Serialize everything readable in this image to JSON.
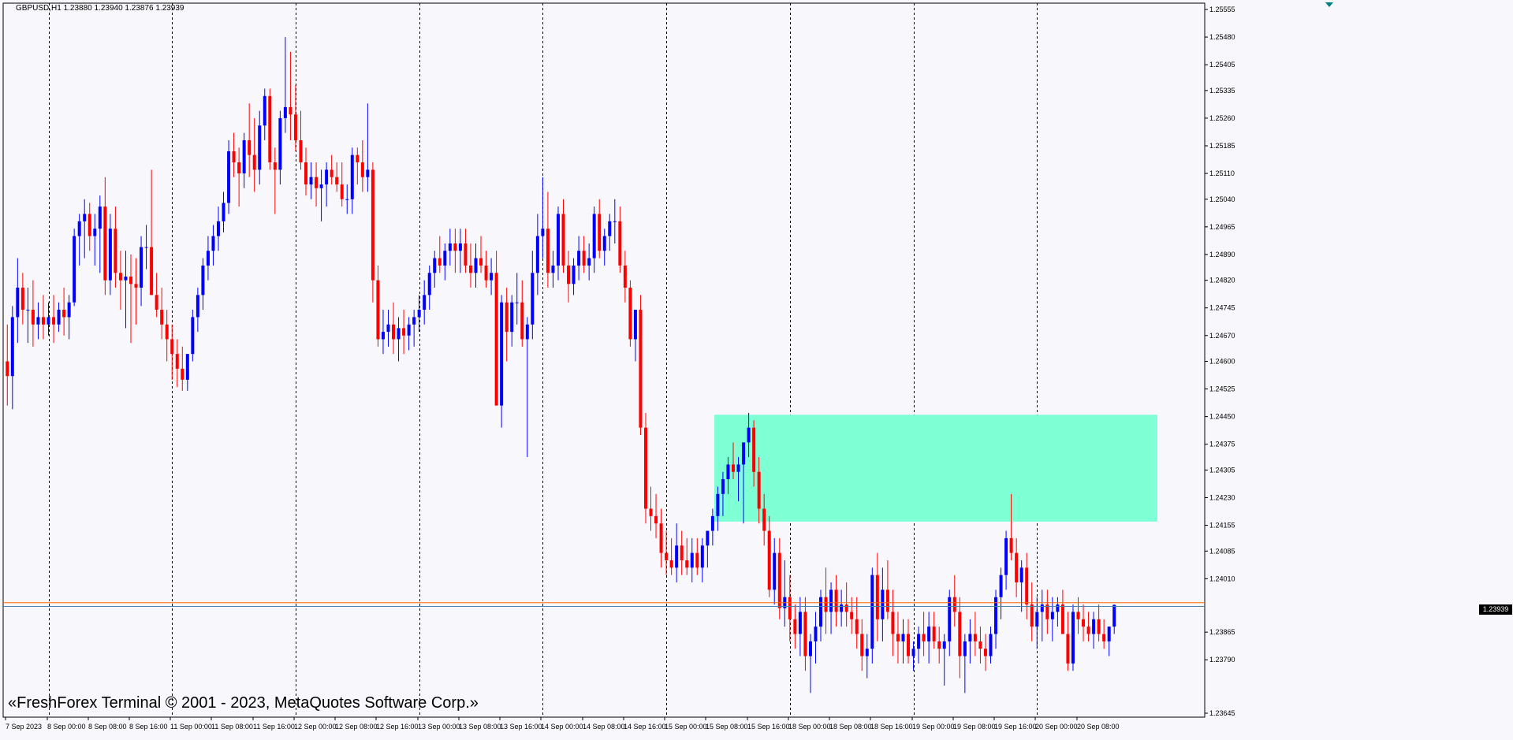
{
  "window": {
    "symbol_info": "GBPUSD,H1  1.23880 1.23940 1.23876 1.23939",
    "copyright": "«FreshForex Terminal © 2001 - 2023, MetaQuotes Software Corp.»"
  },
  "current_price_label": "1.23939",
  "colors": {
    "background": "#f8f8fc",
    "bull": "#0000ff",
    "bear": "#ff0000",
    "zone": "#7fffd4",
    "bid_line": "#ff6600",
    "ask_line": "#4682b4"
  },
  "chart_data": {
    "type": "candlestick",
    "symbol": "GBPUSD",
    "timeframe": "H1",
    "ohlc_header": {
      "open": 1.2388,
      "high": 1.2394,
      "low": 1.23876,
      "close": 1.23939
    },
    "ylim": [
      1.23645,
      1.25555
    ],
    "y_ticks": [
      "1.25555",
      "1.25480",
      "1.25405",
      "1.25335",
      "1.25260",
      "1.25185",
      "1.25110",
      "1.25040",
      "1.24965",
      "1.24890",
      "1.24820",
      "1.24745",
      "1.24670",
      "1.24600",
      "1.24525",
      "1.24450",
      "1.24375",
      "1.24305",
      "1.24230",
      "1.24155",
      "1.24085",
      "1.24010",
      "1.23939",
      "1.23865",
      "1.23790",
      "1.23645"
    ],
    "x_ticks": [
      "7 Sep 2023",
      "8 Sep 00:00",
      "8 Sep 08:00",
      "8 Sep 16:00",
      "11 Sep 00:00",
      "11 Sep 08:00",
      "11 Sep 16:00",
      "12 Sep 00:00",
      "12 Sep 08:00",
      "12 Sep 16:00",
      "13 Sep 00:00",
      "13 Sep 08:00",
      "13 Sep 16:00",
      "14 Sep 00:00",
      "14 Sep 08:00",
      "14 Sep 16:00",
      "15 Sep 00:00",
      "15 Sep 08:00",
      "15 Sep 16:00",
      "18 Sep 00:00",
      "18 Sep 08:00",
      "18 Sep 16:00",
      "19 Sep 00:00",
      "19 Sep 08:00",
      "19 Sep 16:00",
      "20 Sep 00:00",
      "20 Sep 08:00"
    ],
    "zone": {
      "price_top": 1.24455,
      "price_bottom": 1.24165
    },
    "bid_line": 1.23945,
    "ask_line": 1.23939,
    "candles": [
      [
        1.246,
        1.247,
        1.2448,
        1.2456
      ],
      [
        1.2456,
        1.2475,
        1.2447,
        1.2472
      ],
      [
        1.2472,
        1.2488,
        1.2465,
        1.248
      ],
      [
        1.248,
        1.2484,
        1.247,
        1.2474
      ],
      [
        1.2474,
        1.248,
        1.2465,
        1.2474
      ],
      [
        1.2474,
        1.2482,
        1.2464,
        1.247
      ],
      [
        1.247,
        1.2476,
        1.2466,
        1.2472
      ],
      [
        1.2472,
        1.2478,
        1.2466,
        1.247
      ],
      [
        1.247,
        1.2476,
        1.2467,
        1.2472
      ],
      [
        1.2472,
        1.2478,
        1.2465,
        1.247
      ],
      [
        1.247,
        1.2476,
        1.2468,
        1.2474
      ],
      [
        1.2474,
        1.248,
        1.2467,
        1.2472
      ],
      [
        1.2472,
        1.2478,
        1.2466,
        1.2476
      ],
      [
        1.2476,
        1.2496,
        1.2475,
        1.2494
      ],
      [
        1.2494,
        1.25,
        1.2486,
        1.2498
      ],
      [
        1.2498,
        1.2504,
        1.2488,
        1.25
      ],
      [
        1.25,
        1.2503,
        1.249,
        1.2494
      ],
      [
        1.2494,
        1.25,
        1.2486,
        1.2496
      ],
      [
        1.2496,
        1.2505,
        1.2484,
        1.2502
      ],
      [
        1.2502,
        1.251,
        1.2478,
        1.2482
      ],
      [
        1.2482,
        1.25,
        1.2478,
        1.2496
      ],
      [
        1.2496,
        1.2502,
        1.248,
        1.2484
      ],
      [
        1.2484,
        1.249,
        1.2474,
        1.2482
      ],
      [
        1.2482,
        1.249,
        1.2469,
        1.2483
      ],
      [
        1.2483,
        1.2489,
        1.2465,
        1.2481
      ],
      [
        1.2481,
        1.2488,
        1.247,
        1.248
      ],
      [
        1.248,
        1.2494,
        1.2475,
        1.2491
      ],
      [
        1.2491,
        1.2497,
        1.2485,
        1.2491
      ],
      [
        1.2491,
        1.2512,
        1.2485,
        1.2478
      ],
      [
        1.2478,
        1.2484,
        1.2472,
        1.2474
      ],
      [
        1.2474,
        1.248,
        1.2466,
        1.247
      ],
      [
        1.247,
        1.2474,
        1.246,
        1.2466
      ],
      [
        1.2466,
        1.247,
        1.2455,
        1.2462
      ],
      [
        1.2462,
        1.2466,
        1.2453,
        1.2458
      ],
      [
        1.2458,
        1.2464,
        1.2452,
        1.2455
      ],
      [
        1.2455,
        1.2462,
        1.2452,
        1.2462
      ],
      [
        1.2462,
        1.2474,
        1.246,
        1.2472
      ],
      [
        1.2472,
        1.248,
        1.2468,
        1.2478
      ],
      [
        1.2478,
        1.2488,
        1.2474,
        1.2486
      ],
      [
        1.2486,
        1.2494,
        1.2482,
        1.249
      ],
      [
        1.249,
        1.2497,
        1.2486,
        1.2494
      ],
      [
        1.2494,
        1.2502,
        1.249,
        1.2498
      ],
      [
        1.2498,
        1.2506,
        1.2495,
        1.2503
      ],
      [
        1.2503,
        1.252,
        1.25,
        1.2517
      ],
      [
        1.2517,
        1.2522,
        1.251,
        1.2514
      ],
      [
        1.2514,
        1.2518,
        1.2502,
        1.2511
      ],
      [
        1.2511,
        1.2522,
        1.2507,
        1.252
      ],
      [
        1.252,
        1.253,
        1.251,
        1.2516
      ],
      [
        1.2516,
        1.2526,
        1.2506,
        1.2512
      ],
      [
        1.2512,
        1.2528,
        1.2508,
        1.2524
      ],
      [
        1.2524,
        1.2534,
        1.252,
        1.2532
      ],
      [
        1.2532,
        1.2534,
        1.2512,
        1.2514
      ],
      [
        1.2514,
        1.2518,
        1.25,
        1.2512
      ],
      [
        1.2512,
        1.2528,
        1.2508,
        1.2526
      ],
      [
        1.2526,
        1.2548,
        1.2522,
        1.2529
      ],
      [
        1.2529,
        1.2544,
        1.252,
        1.2527
      ],
      [
        1.2527,
        1.2535,
        1.2517,
        1.252
      ],
      [
        1.252,
        1.2528,
        1.2512,
        1.2514
      ],
      [
        1.2514,
        1.2518,
        1.2505,
        1.2508
      ],
      [
        1.2508,
        1.2514,
        1.2504,
        1.251
      ],
      [
        1.251,
        1.2514,
        1.2502,
        1.2507
      ],
      [
        1.2507,
        1.2512,
        1.2498,
        1.2508
      ],
      [
        1.2508,
        1.2514,
        1.2502,
        1.2512
      ],
      [
        1.2512,
        1.2516,
        1.2508,
        1.251
      ],
      [
        1.251,
        1.2514,
        1.2506,
        1.2508
      ],
      [
        1.2508,
        1.2514,
        1.2502,
        1.2504
      ],
      [
        1.2504,
        1.2508,
        1.25,
        1.2504
      ],
      [
        1.2504,
        1.2518,
        1.25,
        1.2516
      ],
      [
        1.2516,
        1.2518,
        1.2508,
        1.2514
      ],
      [
        1.2514,
        1.252,
        1.2506,
        1.251
      ],
      [
        1.251,
        1.253,
        1.2506,
        1.2512
      ],
      [
        1.2512,
        1.2514,
        1.2476,
        1.2482
      ],
      [
        1.2482,
        1.2486,
        1.2464,
        1.2466
      ],
      [
        1.2466,
        1.2474,
        1.2462,
        1.2468
      ],
      [
        1.2468,
        1.2474,
        1.2464,
        1.247
      ],
      [
        1.247,
        1.2476,
        1.2462,
        1.2466
      ],
      [
        1.2466,
        1.2472,
        1.246,
        1.2469
      ],
      [
        1.2469,
        1.2474,
        1.2462,
        1.2467
      ],
      [
        1.2467,
        1.2472,
        1.2463,
        1.247
      ],
      [
        1.247,
        1.2474,
        1.2464,
        1.2472
      ],
      [
        1.2472,
        1.2478,
        1.2468,
        1.2474
      ],
      [
        1.2474,
        1.2482,
        1.247,
        1.2478
      ],
      [
        1.2478,
        1.2486,
        1.2474,
        1.2484
      ],
      [
        1.2484,
        1.249,
        1.248,
        1.2488
      ],
      [
        1.2488,
        1.2494,
        1.2484,
        1.2486
      ],
      [
        1.2486,
        1.2492,
        1.2482,
        1.249
      ],
      [
        1.249,
        1.2496,
        1.2486,
        1.2492
      ],
      [
        1.2492,
        1.2496,
        1.2484,
        1.249
      ],
      [
        1.249,
        1.2496,
        1.2484,
        1.2492
      ],
      [
        1.2492,
        1.2496,
        1.2484,
        1.2486
      ],
      [
        1.2486,
        1.2492,
        1.248,
        1.2484
      ],
      [
        1.2484,
        1.2492,
        1.248,
        1.2488
      ],
      [
        1.2488,
        1.2494,
        1.2484,
        1.2486
      ],
      [
        1.2486,
        1.249,
        1.248,
        1.2482
      ],
      [
        1.2482,
        1.2488,
        1.2478,
        1.2484
      ],
      [
        1.2484,
        1.249,
        1.246,
        1.2448
      ],
      [
        1.2448,
        1.2478,
        1.2442,
        1.2476
      ],
      [
        1.2476,
        1.248,
        1.246,
        1.2468
      ],
      [
        1.2468,
        1.2478,
        1.2464,
        1.2476
      ],
      [
        1.2476,
        1.2484,
        1.247,
        1.2476
      ],
      [
        1.2476,
        1.2482,
        1.2464,
        1.2466
      ],
      [
        1.2466,
        1.2472,
        1.2434,
        1.247
      ],
      [
        1.247,
        1.249,
        1.2466,
        1.2484
      ],
      [
        1.2484,
        1.25,
        1.2478,
        1.2494
      ],
      [
        1.2494,
        1.251,
        1.2488,
        1.2496
      ],
      [
        1.2496,
        1.2506,
        1.248,
        1.2484
      ],
      [
        1.2484,
        1.249,
        1.248,
        1.2486
      ],
      [
        1.2486,
        1.2502,
        1.2482,
        1.25
      ],
      [
        1.25,
        1.2504,
        1.2484,
        1.2486
      ],
      [
        1.2486,
        1.249,
        1.2476,
        1.2481
      ],
      [
        1.2481,
        1.2488,
        1.2478,
        1.2486
      ],
      [
        1.2486,
        1.2494,
        1.2482,
        1.249
      ],
      [
        1.249,
        1.2494,
        1.2484,
        1.2486
      ],
      [
        1.2486,
        1.2492,
        1.2482,
        1.2488
      ],
      [
        1.2488,
        1.2502,
        1.2484,
        1.25
      ],
      [
        1.25,
        1.2504,
        1.2488,
        1.249
      ],
      [
        1.249,
        1.2496,
        1.2486,
        1.2494
      ],
      [
        1.2494,
        1.25,
        1.249,
        1.2498
      ],
      [
        1.2498,
        1.2504,
        1.2492,
        1.2498
      ],
      [
        1.2498,
        1.2502,
        1.2484,
        1.2486
      ],
      [
        1.2486,
        1.249,
        1.2476,
        1.248
      ],
      [
        1.248,
        1.2482,
        1.2464,
        1.2466
      ],
      [
        1.2466,
        1.247,
        1.246,
        1.2474
      ],
      [
        1.2474,
        1.2478,
        1.244,
        1.2442
      ],
      [
        1.2442,
        1.2446,
        1.2416,
        1.242
      ],
      [
        1.242,
        1.2426,
        1.2414,
        1.2418
      ],
      [
        1.2418,
        1.2424,
        1.2412,
        1.2416
      ],
      [
        1.2416,
        1.242,
        1.2404,
        1.2408
      ],
      [
        1.2408,
        1.2414,
        1.2402,
        1.2406
      ],
      [
        1.2406,
        1.2412,
        1.2402,
        1.2404
      ],
      [
        1.2404,
        1.2416,
        1.24,
        1.241
      ],
      [
        1.241,
        1.2414,
        1.2402,
        1.2406
      ],
      [
        1.2406,
        1.2412,
        1.2402,
        1.2404
      ],
      [
        1.2404,
        1.2412,
        1.24,
        1.2408
      ],
      [
        1.2408,
        1.2412,
        1.2402,
        1.2404
      ],
      [
        1.2404,
        1.2412,
        1.24,
        1.241
      ],
      [
        1.241,
        1.2414,
        1.2404,
        1.2414
      ],
      [
        1.2414,
        1.242,
        1.241,
        1.2418
      ],
      [
        1.2418,
        1.2426,
        1.2414,
        1.2424
      ],
      [
        1.2424,
        1.243,
        1.2418,
        1.2428
      ],
      [
        1.2428,
        1.2434,
        1.2424,
        1.2432
      ],
      [
        1.2432,
        1.2438,
        1.2428,
        1.243
      ],
      [
        1.243,
        1.2434,
        1.2422,
        1.2432
      ],
      [
        1.2432,
        1.2436,
        1.2416,
        1.2438
      ],
      [
        1.2438,
        1.2446,
        1.2434,
        1.2442
      ],
      [
        1.2442,
        1.2444,
        1.2426,
        1.243
      ],
      [
        1.243,
        1.2434,
        1.2416,
        1.242
      ],
      [
        1.242,
        1.2424,
        1.241,
        1.2414
      ],
      [
        1.2414,
        1.2418,
        1.2396,
        1.2398
      ],
      [
        1.2398,
        1.2412,
        1.2394,
        1.2408
      ],
      [
        1.2408,
        1.2412,
        1.239,
        1.2393
      ],
      [
        1.2393,
        1.2406,
        1.2388,
        1.2396
      ],
      [
        1.2396,
        1.2402,
        1.2384,
        1.239
      ],
      [
        1.239,
        1.2394,
        1.2382,
        1.2386
      ],
      [
        1.2386,
        1.2396,
        1.238,
        1.2392
      ],
      [
        1.2392,
        1.2396,
        1.2376,
        1.238
      ],
      [
        1.238,
        1.2386,
        1.237,
        1.2384
      ],
      [
        1.2384,
        1.2392,
        1.2378,
        1.2388
      ],
      [
        1.2388,
        1.2398,
        1.2384,
        1.2396
      ],
      [
        1.2396,
        1.2404,
        1.2386,
        1.2392
      ],
      [
        1.2392,
        1.24,
        1.2386,
        1.2398
      ],
      [
        1.2398,
        1.2402,
        1.2388,
        1.2392
      ],
      [
        1.2392,
        1.2398,
        1.2388,
        1.2394
      ],
      [
        1.2394,
        1.24,
        1.2388,
        1.2392
      ],
      [
        1.2392,
        1.2396,
        1.2386,
        1.239
      ],
      [
        1.239,
        1.2396,
        1.2382,
        1.2386
      ],
      [
        1.2386,
        1.239,
        1.2376,
        1.238
      ],
      [
        1.238,
        1.2386,
        1.2374,
        1.2382
      ],
      [
        1.2382,
        1.2404,
        1.2378,
        1.2402
      ],
      [
        1.2402,
        1.2408,
        1.2384,
        1.239
      ],
      [
        1.239,
        1.2404,
        1.2384,
        1.2398
      ],
      [
        1.2398,
        1.2406,
        1.239,
        1.2392
      ],
      [
        1.2392,
        1.2398,
        1.238,
        1.2386
      ],
      [
        1.2386,
        1.2392,
        1.2378,
        1.2384
      ],
      [
        1.2384,
        1.239,
        1.2378,
        1.2386
      ],
      [
        1.2386,
        1.239,
        1.2378,
        1.238
      ],
      [
        1.238,
        1.2384,
        1.2376,
        1.2382
      ],
      [
        1.2382,
        1.2388,
        1.2378,
        1.2386
      ],
      [
        1.2386,
        1.2392,
        1.238,
        1.2384
      ],
      [
        1.2384,
        1.2392,
        1.2378,
        1.2388
      ],
      [
        1.2388,
        1.2392,
        1.2382,
        1.2384
      ],
      [
        1.2384,
        1.2388,
        1.2378,
        1.2382
      ],
      [
        1.2382,
        1.2386,
        1.2372,
        1.2384
      ],
      [
        1.2384,
        1.2398,
        1.238,
        1.2396
      ],
      [
        1.2396,
        1.2402,
        1.2388,
        1.2392
      ],
      [
        1.2392,
        1.2396,
        1.2374,
        1.238
      ],
      [
        1.238,
        1.2386,
        1.237,
        1.2384
      ],
      [
        1.2384,
        1.239,
        1.2378,
        1.2386
      ],
      [
        1.2386,
        1.2392,
        1.238,
        1.2384
      ],
      [
        1.2384,
        1.2388,
        1.2378,
        1.2382
      ],
      [
        1.2382,
        1.2386,
        1.2376,
        1.238
      ],
      [
        1.238,
        1.2388,
        1.2378,
        1.2386
      ],
      [
        1.2386,
        1.2398,
        1.2382,
        1.2396
      ],
      [
        1.2396,
        1.2404,
        1.239,
        1.2402
      ],
      [
        1.2402,
        1.2414,
        1.2398,
        1.2412
      ],
      [
        1.2412,
        1.2424,
        1.2406,
        1.2408
      ],
      [
        1.2408,
        1.2412,
        1.2396,
        1.24
      ],
      [
        1.24,
        1.2406,
        1.2392,
        1.2404
      ],
      [
        1.2404,
        1.2408,
        1.239,
        1.2394
      ],
      [
        1.2394,
        1.24,
        1.2384,
        1.2388
      ],
      [
        1.2388,
        1.2396,
        1.2382,
        1.2392
      ],
      [
        1.2392,
        1.2398,
        1.2384,
        1.2394
      ],
      [
        1.2394,
        1.2398,
        1.2386,
        1.239
      ],
      [
        1.239,
        1.2396,
        1.2384,
        1.2392
      ],
      [
        1.2392,
        1.2396,
        1.2388,
        1.2394
      ],
      [
        1.2394,
        1.2398,
        1.2386,
        1.2386
      ],
      [
        1.2386,
        1.2392,
        1.2376,
        1.2378
      ],
      [
        1.2378,
        1.2394,
        1.2376,
        1.2392
      ],
      [
        1.2392,
        1.2396,
        1.2386,
        1.239
      ],
      [
        1.239,
        1.2394,
        1.2384,
        1.2388
      ],
      [
        1.2388,
        1.2392,
        1.2384,
        1.2386
      ],
      [
        1.2386,
        1.2392,
        1.2382,
        1.239
      ],
      [
        1.239,
        1.2394,
        1.2384,
        1.2386
      ],
      [
        1.2386,
        1.239,
        1.2382,
        1.2384
      ],
      [
        1.2384,
        1.2388,
        1.238,
        1.2388
      ],
      [
        1.2388,
        1.2394,
        1.2386,
        1.23939
      ]
    ]
  }
}
